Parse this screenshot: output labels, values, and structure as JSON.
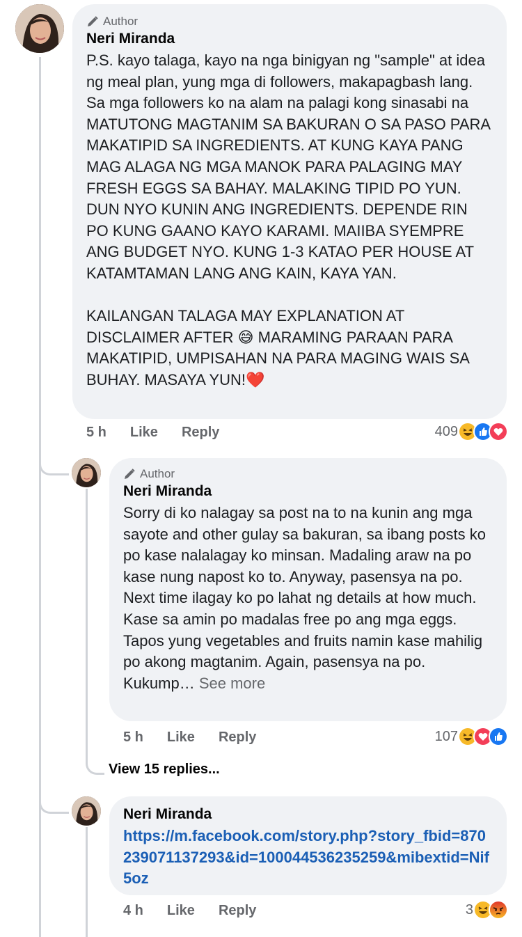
{
  "comments": [
    {
      "author_badge": "Author",
      "name": "Neri Miranda",
      "text": "P.S. kayo talaga, kayo na nga binigyan ng \"sample\" at idea ng meal plan, yung mga di followers, makapagbash lang. Sa mga followers ko na alam na palagi kong sinasabi na MATUTONG MAGTANIM SA BAKURAN O SA PASO PARA MAKATIPID SA INGREDIENTS. AT KUNG KAYA PANG MAG ALAGA NG MGA MANOK PARA PALAGING MAY FRESH EGGS SA BAHAY. MALAKING TIPID PO YUN. DUN NYO KUNIN ANG INGREDIENTS. DEPENDE RIN PO KUNG GAANO KAYO KARAMI. MAIIBA SYEMPRE ANG BUDGET NYO. KUNG 1-3 KATAO PER HOUSE AT KATAMTAMAN LANG ANG KAIN, KAYA YAN.",
      "text2_a": "KAILANGAN TALAGA MAY EXPLANATION AT DISCLAIMER AFTER ",
      "text2_emoji": "😅",
      "text2_b": " MARAMING PARAAN PARA MAKATIPID, UMPISAHAN NA PARA MAGING WAIS SA BUHAY. MASAYA YUN!",
      "text2_heart": "❤️",
      "time": "5 h",
      "like": "Like",
      "reply": "Reply",
      "reaction_count": "409",
      "reactions": [
        "haha-icon",
        "like-icon",
        "love-icon"
      ]
    },
    {
      "author_badge": "Author",
      "name": "Neri Miranda",
      "text": "Sorry di ko nalagay sa post na to na kunin ang mga sayote and other gulay sa bakuran, sa ibang posts ko po kase nalalagay ko minsan. Madaling araw na po kase nung napost ko to. Anyway, pasensya na po. Next time ilagay ko po lahat ng details at how much. Kase sa amin po madalas free po ang mga eggs. Tapos yung vegetables and fruits namin kase mahilig po akong magtanim. Again, pasensya na po. Kukump…",
      "see_more": " See more",
      "time": "5 h",
      "like": "Like",
      "reply": "Reply",
      "reaction_count": "107",
      "reactions": [
        "haha-icon",
        "love-icon",
        "like-icon"
      ],
      "view_replies": "View 15 replies..."
    },
    {
      "name": "Neri Miranda",
      "link": "https://m.facebook.com/story.php?story_fbid=870239071137293&id=100044536235259&mibextid=Nif5oz",
      "time": "4 h",
      "like": "Like",
      "reply": "Reply",
      "reaction_count": "3",
      "reactions": [
        "haha-icon",
        "angry-icon"
      ]
    }
  ],
  "colors": {
    "bubble": "#f0f2f5",
    "link": "#1b5fb5",
    "meta": "#65676b",
    "like_blue": "#1877f2",
    "love_red": "#f33e58",
    "haha_yellow": "#f7b928",
    "angry_orange": "#e9710f"
  }
}
